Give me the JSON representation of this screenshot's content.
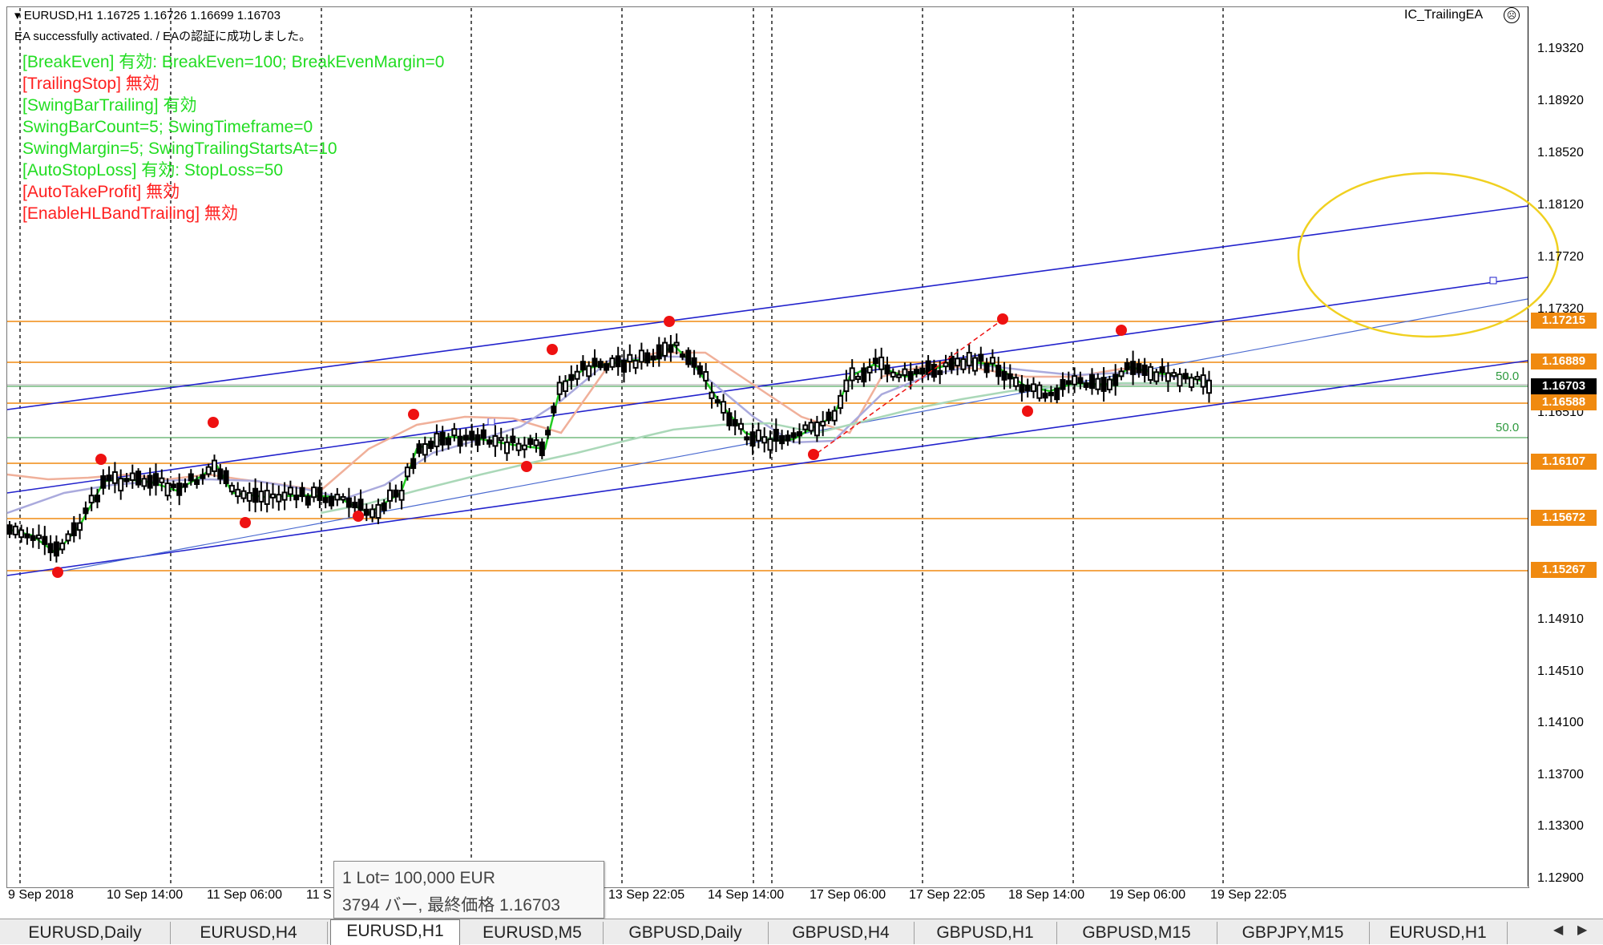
{
  "window": {
    "symbol_line": "EURUSD,H1  1.16725 1.16726 1.16699 1.16703",
    "ea_status": "EA successfully activated. / EAの認証に成功しました。",
    "ea_name": "IC_TrailingEA",
    "ea_close_icon": "☹"
  },
  "status_lines": [
    {
      "text": "[BreakEven] 有効: BreakEven=100; BreakEvenMargin=0",
      "color": "#22dd22"
    },
    {
      "text": "[TrailingStop] 無効",
      "color": "#ff2020"
    },
    {
      "text": "[SwingBarTrailing] 有効",
      "color": "#22dd22"
    },
    {
      "text": "SwingBarCount=5; SwingTimeframe=0",
      "color": "#22dd22"
    },
    {
      "text": "SwingMargin=5; SwingTrailingStartsAt=10",
      "color": "#22dd22"
    },
    {
      "text": "[AutoStopLoss] 有効: StopLoss=50",
      "color": "#22dd22"
    },
    {
      "text": "[AutoTakeProfit] 無効",
      "color": "#ff2020"
    },
    {
      "text": "[EnableHLBandTrailing] 無効",
      "color": "#ff2020"
    }
  ],
  "price_scale": {
    "ticks": [
      "1.19320",
      "1.18920",
      "1.18520",
      "1.18120",
      "1.17720",
      "1.17320",
      "1.16510",
      "1.14910",
      "1.14510",
      "1.14100",
      "1.13700",
      "1.13300",
      "1.12900"
    ],
    "levels": [
      {
        "label": "1.17215",
        "color": "#f08a10"
      },
      {
        "label": "1.16889",
        "color": "#f08a10"
      },
      {
        "label": "1.16703",
        "color": "#000000"
      },
      {
        "label": "1.16588",
        "color": "#f08a10"
      },
      {
        "label": "1.16107",
        "color": "#f08a10"
      },
      {
        "label": "1.15672",
        "color": "#f08a10"
      },
      {
        "label": "1.15267",
        "color": "#f08a10"
      }
    ],
    "fib_labels": [
      "50.0",
      "50.0"
    ]
  },
  "time_axis": {
    "labels": [
      "9 Sep 2018",
      "10 Sep 14:00",
      "11 Sep 06:00",
      "11 S",
      "13 Sep 22:05",
      "14 Sep 14:00",
      "17 Sep 06:00",
      "17 Sep 22:05",
      "18 Sep 14:00",
      "19 Sep 06:00",
      "19 Sep 22:05"
    ]
  },
  "tooltip": {
    "line1": "1 Lot= 100,000 EUR",
    "line2": "3794 バー, 最終価格 1.16703"
  },
  "tabs": [
    "EURUSD,Daily",
    "EURUSD,H4",
    "EURUSD,H1",
    "EURUSD,M5",
    "GBPUSD,Daily",
    "GBPUSD,H4",
    "GBPUSD,H1",
    "GBPUSD,M15",
    "GBPJPY,M15",
    "EURUSD,H1"
  ],
  "active_tab": "EURUSD,H1",
  "colors": {
    "candle": "#000000",
    "ma_fast": "#22cc22",
    "ma_slow": "#9999cc",
    "channel": "#2222cc",
    "level": "#f08a10",
    "swing_point": "#ee1111",
    "annotation": "#f0d020"
  }
}
